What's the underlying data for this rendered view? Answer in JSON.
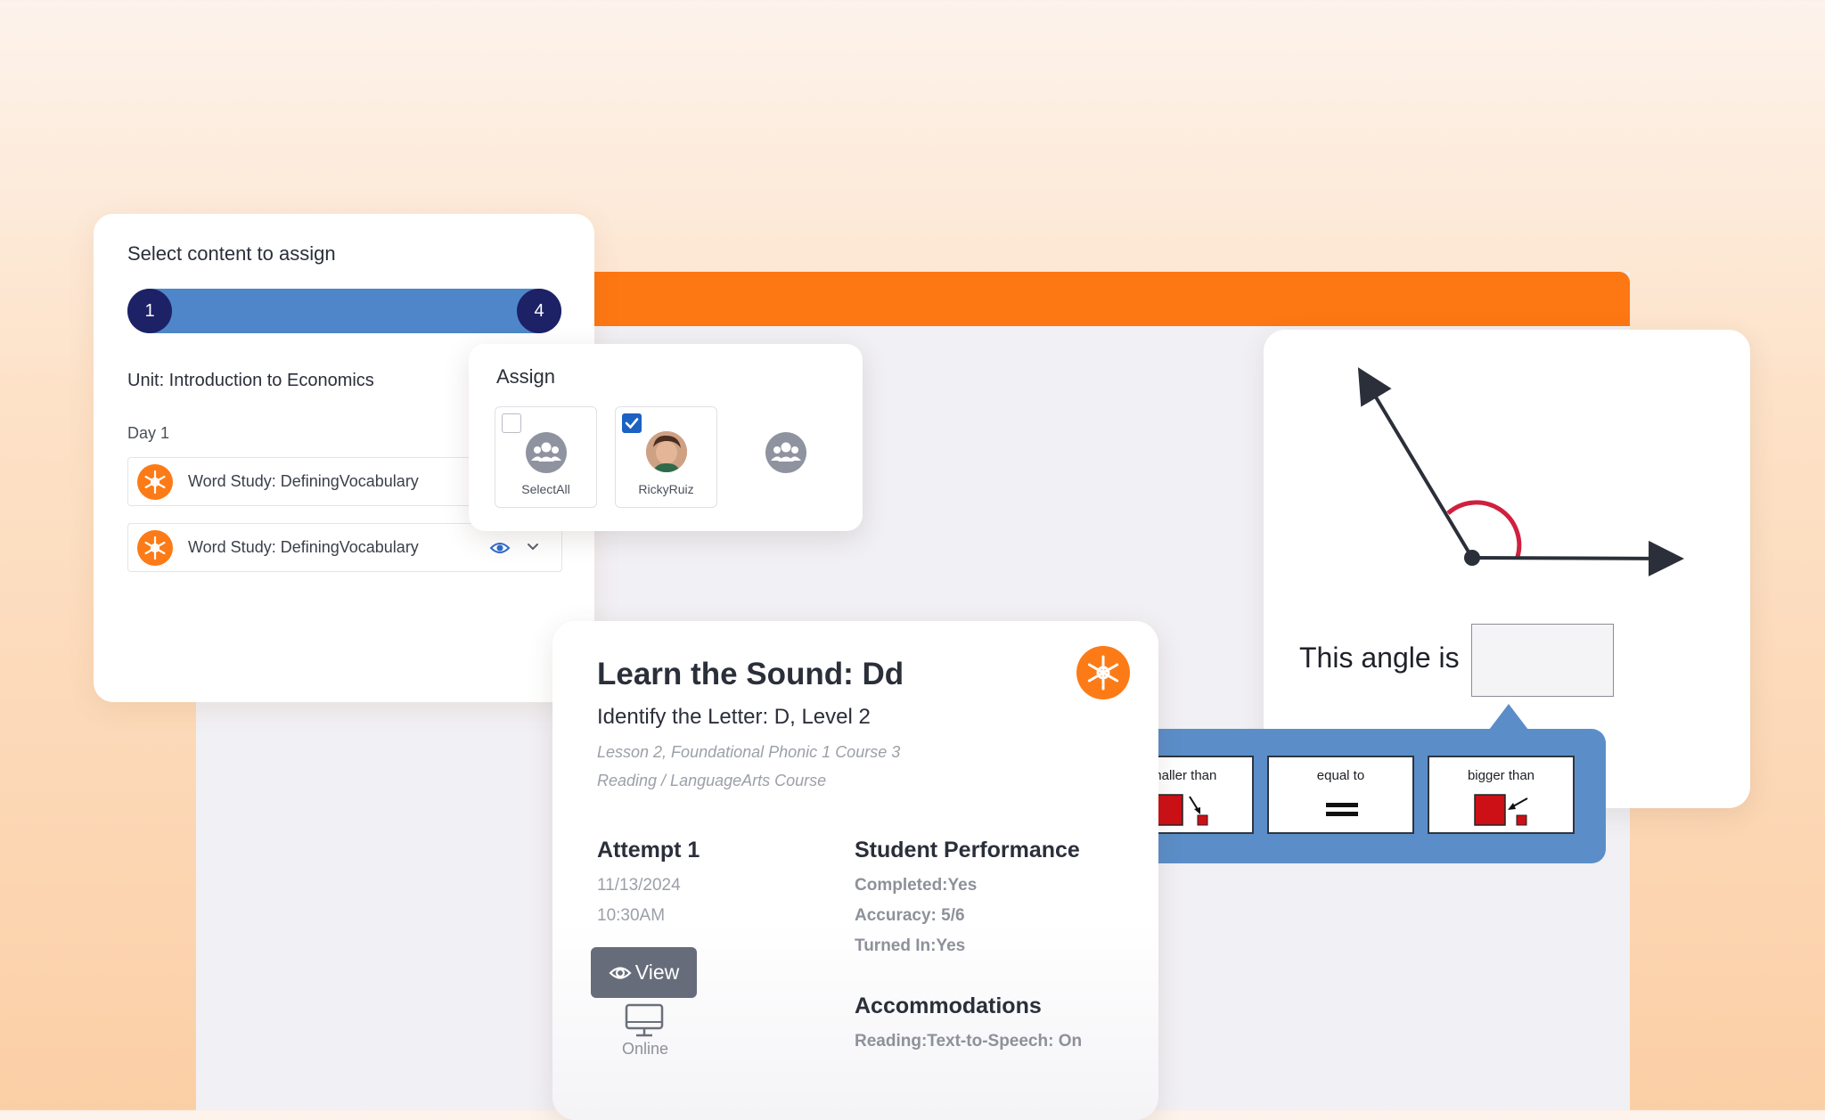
{
  "content_selector": {
    "title": "Select content to assign",
    "steps": {
      "start": "1",
      "end": "4"
    },
    "unit": "Unit: Introduction to Economics",
    "day": "Day 1",
    "items": [
      {
        "label": "Word Study: DefiningVocabulary",
        "icon": "snowflake-icon"
      },
      {
        "label": "Word Study: DefiningVocabulary",
        "icon": "snowflake-icon"
      }
    ]
  },
  "assign": {
    "title": "Assign",
    "students": [
      {
        "label": "SelectAll",
        "checked": false,
        "icon": "group-icon"
      },
      {
        "label": "RickyRuiz",
        "checked": true,
        "icon": "student-avatar"
      },
      {
        "label": "",
        "icon": "group-icon"
      }
    ]
  },
  "angle_question": {
    "prompt": "This angle is",
    "answer": ""
  },
  "choices": [
    {
      "label": "smaller than",
      "icon": "smaller-than-icon"
    },
    {
      "label": "equal to",
      "icon": "equal-icon"
    },
    {
      "label": "bigger than",
      "icon": "bigger-than-icon"
    }
  ],
  "lesson": {
    "title": "Learn the Sound: Dd",
    "subtitle": "Identify the Letter: D, Level 2",
    "meta1": "Lesson 2, Foundational Phonic 1 Course 3",
    "meta2": "Reading / LanguageArts Course",
    "attempt": {
      "heading": "Attempt 1",
      "date": "11/13/2024",
      "time": "10:30AM",
      "view_label": "View",
      "mode": "Online"
    },
    "performance": {
      "heading": "Student Performance",
      "completed": "Completed:Yes",
      "accuracy": "Accuracy: 5/6",
      "turned_in": "Turned In:Yes"
    },
    "accommodations": {
      "heading": "Accommodations",
      "value": "Reading:Text-to-Speech: On"
    }
  },
  "colors": {
    "brand_orange": "#fd7713",
    "progress_blue": "#4e86c9",
    "step_navy": "#1d2165",
    "choice_panel": "#5b8ec8",
    "angle_arc": "#d0203f"
  }
}
